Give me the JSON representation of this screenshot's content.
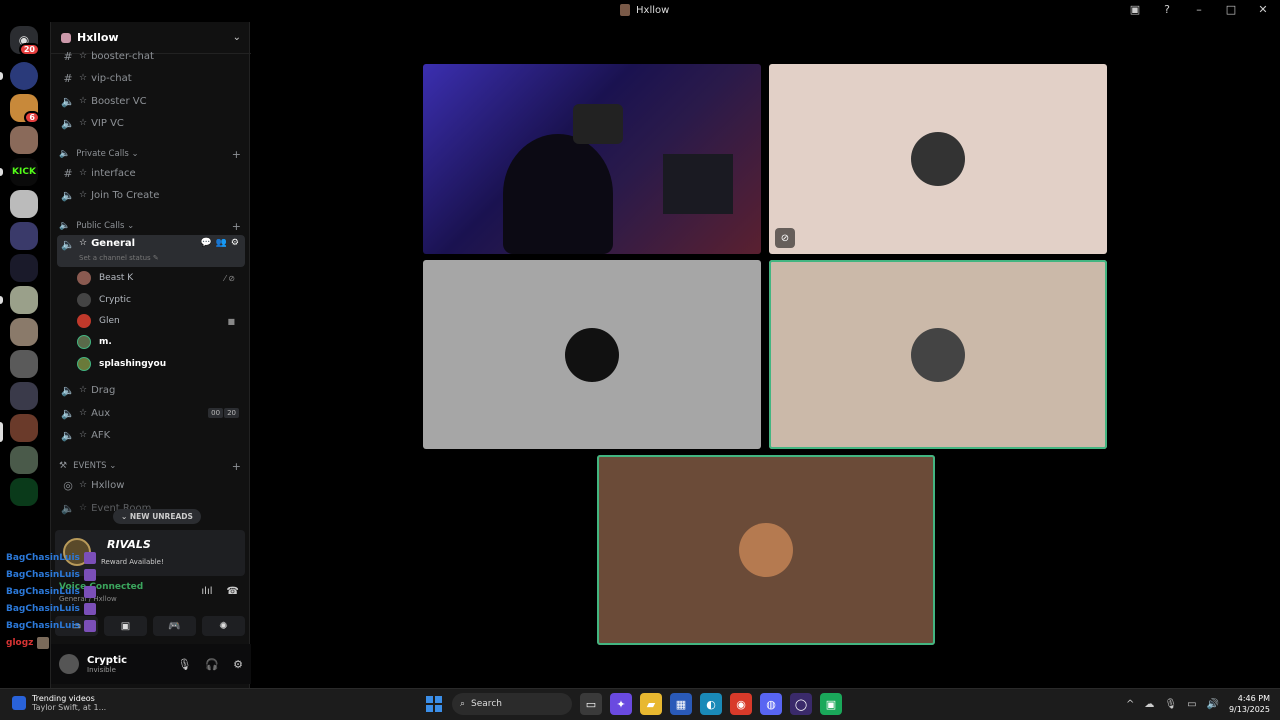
{
  "window": {
    "title": "Hxllow"
  },
  "rail": {
    "top_badge": "20",
    "server_badge": "6",
    "kick_label": "KICK"
  },
  "server": {
    "name": "Hxllow"
  },
  "channels": {
    "booster_chat": "booster-chat",
    "vip_chat": "vip-chat",
    "booster_vc": "Booster VC",
    "vip_vc": "VIP VC",
    "cat_private": "Private Calls",
    "interface": "interface",
    "join_to_create": "Join To Create",
    "cat_public": "Public Calls",
    "general": "General",
    "general_status": "Set a channel status",
    "drag": "Drag",
    "aux": "Aux",
    "aux_badge1": "00",
    "aux_badge2": "20",
    "afk": "AFK",
    "cat_events": "EVENTS",
    "hxllow": "Hxllow",
    "event_room": "Event Room"
  },
  "members": [
    {
      "name": "Beast K",
      "color": "#8a5a50"
    },
    {
      "name": "Cryptic",
      "color": "#444"
    },
    {
      "name": "Glen",
      "color": "#c0392b"
    },
    {
      "name": "m.",
      "color": "#5a6a4a"
    },
    {
      "name": "splashingyou",
      "color": "#6a7a3a"
    }
  ],
  "new_unreads": "NEW UNREADS",
  "rivals": {
    "logo": "RIVALS",
    "text": "Reward Available!"
  },
  "voice": {
    "status": "Voice Connected",
    "channel": "General / Hxllow"
  },
  "overlay": [
    {
      "name": "BagChasinLuis"
    },
    {
      "name": "BagChasinLuis"
    },
    {
      "name": "BagChasinLuis"
    },
    {
      "name": "BagChasinLuis"
    },
    {
      "name": "BagChasinLuis"
    },
    {
      "name": "glogz"
    }
  ],
  "user": {
    "name": "Cryptic",
    "status": "Invisible"
  },
  "tiles": [
    {
      "bg": "#3a2a8a",
      "avatar": null,
      "speaking": false,
      "cam_off": false
    },
    {
      "bg": "#e2d0c7",
      "avatar": "#333",
      "speaking": false,
      "cam_off": true
    },
    {
      "bg": "#a6a6a6",
      "avatar": "#111",
      "speaking": false,
      "cam_off": false
    },
    {
      "bg": "#cbb9a9",
      "avatar": "#444",
      "speaking": true,
      "cam_off": false
    },
    {
      "bg": "#6b4b38",
      "avatar": "#b57a50",
      "speaking": true,
      "cam_off": false
    }
  ],
  "taskbar": {
    "trend_title": "Trending videos",
    "trend_sub": "Taylor Swift, at 1...",
    "search": "Search",
    "time": "4:46 PM",
    "date": "9/13/2025"
  }
}
